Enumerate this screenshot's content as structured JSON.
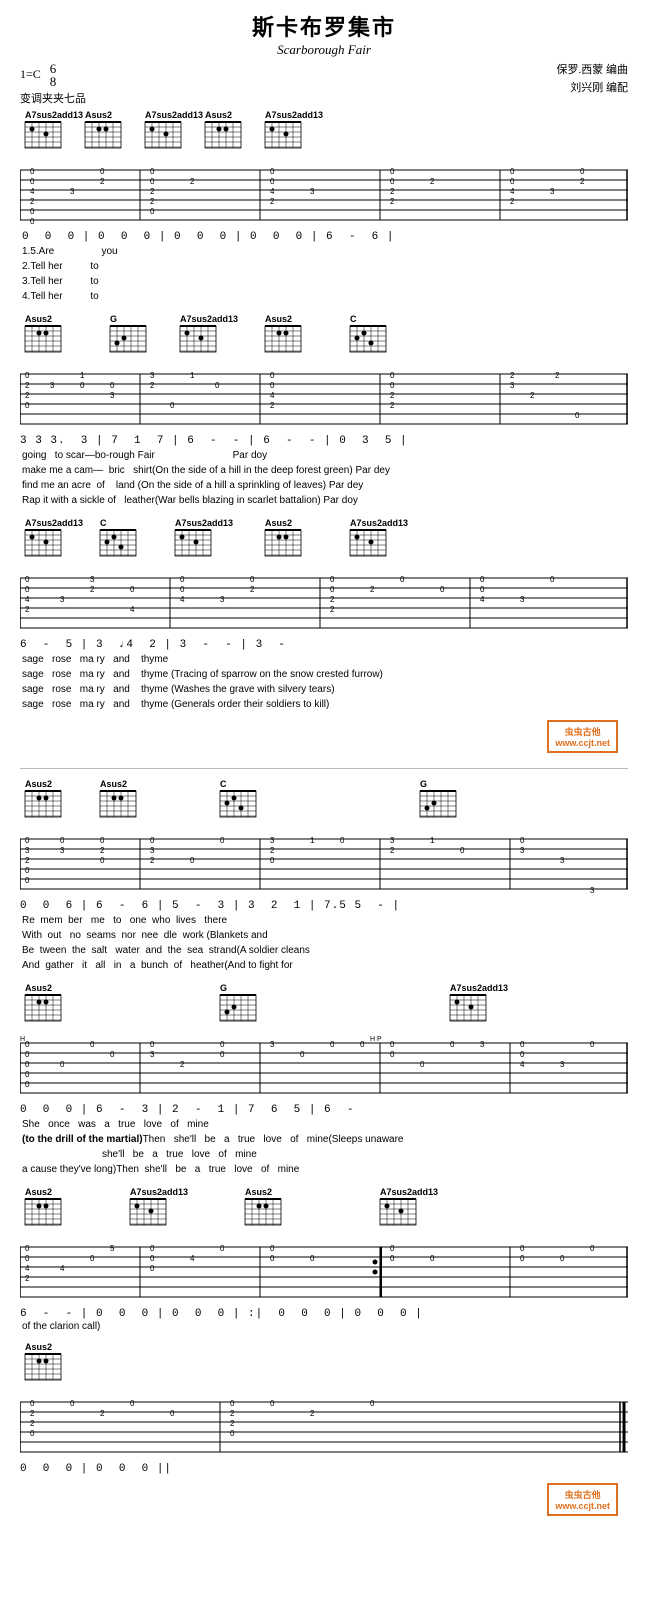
{
  "title": {
    "chinese": "斯卡布罗集市",
    "english": "Scarborough Fair"
  },
  "time_signature": "1=C 6/8",
  "capo": "变调夹夹七品",
  "composer": "保罗.西蒙 编曲",
  "arranger": "刘兴刚 编配",
  "watermark1": "虫虫古他\nwww.ccjt.net",
  "watermark2": "虫虫古他\nwww.ccjt.net",
  "section1": {
    "chords": [
      "A7sus2add13",
      "Asus2",
      "A7sus2add13",
      "Asus2",
      "A7sus2add13"
    ],
    "numbers": "0  0  0 | 0  0  0 | 0  0  0 | 0  0  0 | 6  -  6 |",
    "lyrics": [
      "1.5.Are                  you",
      "2.Tell her          to",
      "3.Tell her          to",
      "4.Tell her          to"
    ]
  },
  "section2": {
    "chords": [
      "Asus2",
      "G",
      "A7sus2add13",
      "Asus2",
      "C"
    ],
    "numbers": "3 3 3.  3 | 7  1  7 | 6  -  - | 6  -  - | 0  3  5 |",
    "lyrics": [
      "going   to  scar—bo-rough  Fair                              Par  doy",
      "make me  a  cam—   bric    shirt(On the side of a hill in the deep forest green) Par dey",
      "find me  an  acre  of      land (On the side of a hill a sprinkling of leaves) Par dey",
      "Rap it with a sickle of    leather(War bells blazing in scarlet battalion) Par doy"
    ]
  },
  "section3": {
    "chords": [
      "A7sus2add13",
      "C",
      "A7sus2add13",
      "Asus2",
      "A7sus2add13"
    ],
    "numbers": "6  -  5 | 3  4  2 | 3  -  - | 3  -",
    "lyrics": [
      "sage   rose   ma  ry   and    thyme",
      "sage   rose   ma  ry   and    thyme (Tracing of sparrow on the snow crested furrow)",
      "sage   rose   ma  ry   and    thyme (Washes the grave with silvery tears)",
      "sage   rose   ma  ry   and    thyme (Generals order their soldiers to kill)"
    ]
  },
  "section4": {
    "chords": [
      "Asus2",
      "Asus2",
      "C",
      "G"
    ],
    "numbers": "0  0  6 | 6  -  6 | 5  -  3 | 3  2  1 | 7.5 5  - |",
    "lyrics": [
      "Re  mem  ber   me   to   one   who  lives   there",
      "With  out   no  seams  nor  nee  dle  work (Blankets and",
      "Be  tween  the  salt   water  and  the  sea  strand(A soldier cleans",
      "And  gather   it   all   in   a  bunch  of   heather(And to fight for"
    ]
  },
  "section5": {
    "chords": [
      "Asus2",
      "G",
      "A7sus2add13"
    ],
    "numbers": "0  0  0 | 6  -  3 | 2  -  1 | 7  6  5 | 6  -",
    "lyrics": [
      "She   once   was   a   true   love   of   mine",
      "(to the drill of the martial)Then   she'll   be   a   true   love   of   mine(Sleeps unaware",
      "she'll   be   a   true   love   of   mine",
      "a cause they've long)Then  she'll   be   a   true   love   of   mine"
    ]
  },
  "section6": {
    "chords": [
      "Asus2",
      "A7sus2add13",
      "Asus2",
      "A7sus2add13"
    ],
    "numbers": "6  -  - | 0  0  0 | 0  0  0 | :| 0  0  0 | 0  0  0 |",
    "lyrics": [
      "of the clarion call)"
    ]
  },
  "section7": {
    "chords": [
      "Asus2"
    ],
    "numbers": "0  0  0 | 0  0  0 ||"
  }
}
